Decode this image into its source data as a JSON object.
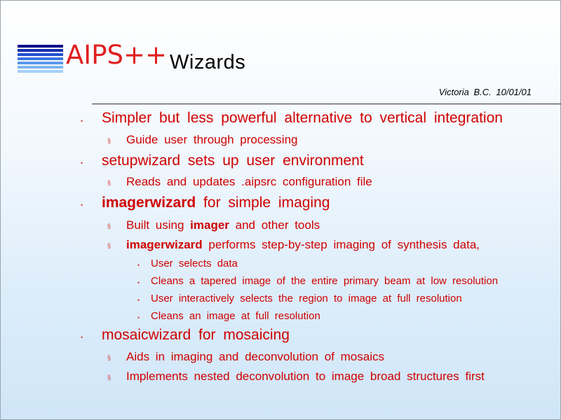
{
  "header": {
    "logo_text": "AIPS++",
    "title": "Wizards",
    "venue": "Victoria B.C. 10/01/01"
  },
  "colors": {
    "text": "#d00000",
    "logo_red": "#e02020",
    "stripes": [
      "#0a0a8a",
      "#1a2fb0",
      "#2450d0",
      "#3a74e0",
      "#5a97ea",
      "#7fb6f0",
      "#a6d0f6"
    ]
  },
  "bullets": {
    "b1": "•",
    "b2": "§",
    "b3": "•"
  },
  "items": [
    {
      "level": 1,
      "text": "Simpler but less powerful alternative to vertical integration"
    },
    {
      "level": 2,
      "text": "Guide user through processing"
    },
    {
      "level": 1,
      "text": "setupwizard sets up user environment"
    },
    {
      "level": 2,
      "text": "Reads and updates .aipsrc configuration file"
    },
    {
      "level": 1,
      "bold": "imagerwizard",
      "rest": " for simple imaging"
    },
    {
      "level": 2,
      "pre": "Built using ",
      "bold": "imager",
      "rest": " and other tools"
    },
    {
      "level": 2,
      "bold": "imagerwizard",
      "rest": " performs step-by-step imaging of synthesis data,"
    },
    {
      "level": 3,
      "text": "User selects data"
    },
    {
      "level": 3,
      "text": "Cleans a tapered image of the entire primary beam at low resolution"
    },
    {
      "level": 3,
      "text": "User interactively selects the region to image at full resolution"
    },
    {
      "level": 3,
      "text": "Cleans an image at full resolution"
    },
    {
      "level": 1,
      "text": "mosaicwizard for mosaicing"
    },
    {
      "level": 2,
      "text": "Aids in imaging and deconvolution of mosaics"
    },
    {
      "level": 2,
      "text": "Implements nested deconvolution to image broad structures first"
    }
  ]
}
